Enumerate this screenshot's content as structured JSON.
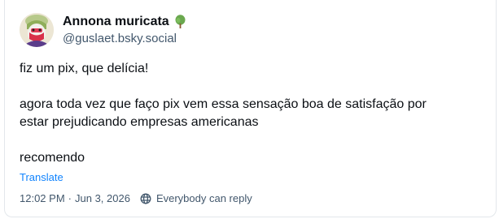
{
  "post": {
    "author": {
      "display_name": "Annona muricata",
      "name_emoji_icon": "tree-icon",
      "handle": "@guslaet.bsky.social",
      "avatar": "avatar-illustration"
    },
    "text": {
      "line1": "fiz um pix, que delícia!",
      "line2": "agora toda vez que faço pix vem essa sensação boa de satisfação por",
      "line3": "estar prejudicando empresas americanas",
      "line4": "recomendo"
    },
    "translate_label": "Translate",
    "time": "12:02 PM",
    "separator": "·",
    "date": "Jun 3, 2026",
    "reply_setting_icon": "globe-icon",
    "reply_setting": "Everybody can reply"
  },
  "colors": {
    "link": "#1083fe",
    "muted": "#42576c",
    "text": "#0b0f14",
    "border": "#e3e7eb"
  }
}
